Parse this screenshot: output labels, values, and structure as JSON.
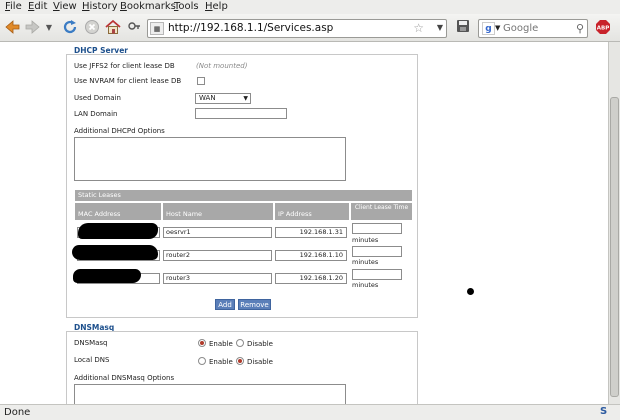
{
  "menu": [
    "File",
    "Edit",
    "View",
    "History",
    "Bookmarks",
    "Tools",
    "Help"
  ],
  "toolbar": {
    "url": "http://192.168.1.1/Services.asp",
    "search_placeholder": "Google",
    "site_icon": "lock-icon"
  },
  "dhcp": {
    "title": "DHCP Server",
    "jffs2_label": "Use JFFS2 for client lease DB",
    "jffs2_status": "(Not mounted)",
    "nvram_label": "Use NVRAM for client lease DB",
    "domain_label": "Used Domain",
    "domain_value": "WAN",
    "lan_domain_label": "LAN Domain",
    "lan_domain_value": "",
    "dhcpd_options_label": "Additional DHCPd Options"
  },
  "static_leases": {
    "title": "Static Leases",
    "columns": [
      "MAC Address",
      "Host Name",
      "IP Address",
      "Client Lease Time"
    ],
    "rows": [
      {
        "host": "oesrvr1",
        "ip": "192.168.1.31",
        "unit": "minutes"
      },
      {
        "host": "router2",
        "ip": "192.168.1.10",
        "unit": "minutes"
      },
      {
        "host": "router3",
        "ip": "192.168.1.20",
        "unit": "minutes"
      }
    ],
    "add_label": "Add",
    "remove_label": "Remove"
  },
  "dnsmasq": {
    "title": "DNSMasq",
    "dnsmasq_label": "DNSMasq",
    "local_dns_label": "Local DNS",
    "enable_label": "Enable",
    "disable_label": "Disable",
    "options_label": "Additional DNSMasq Options"
  },
  "status": {
    "text": "Done"
  }
}
